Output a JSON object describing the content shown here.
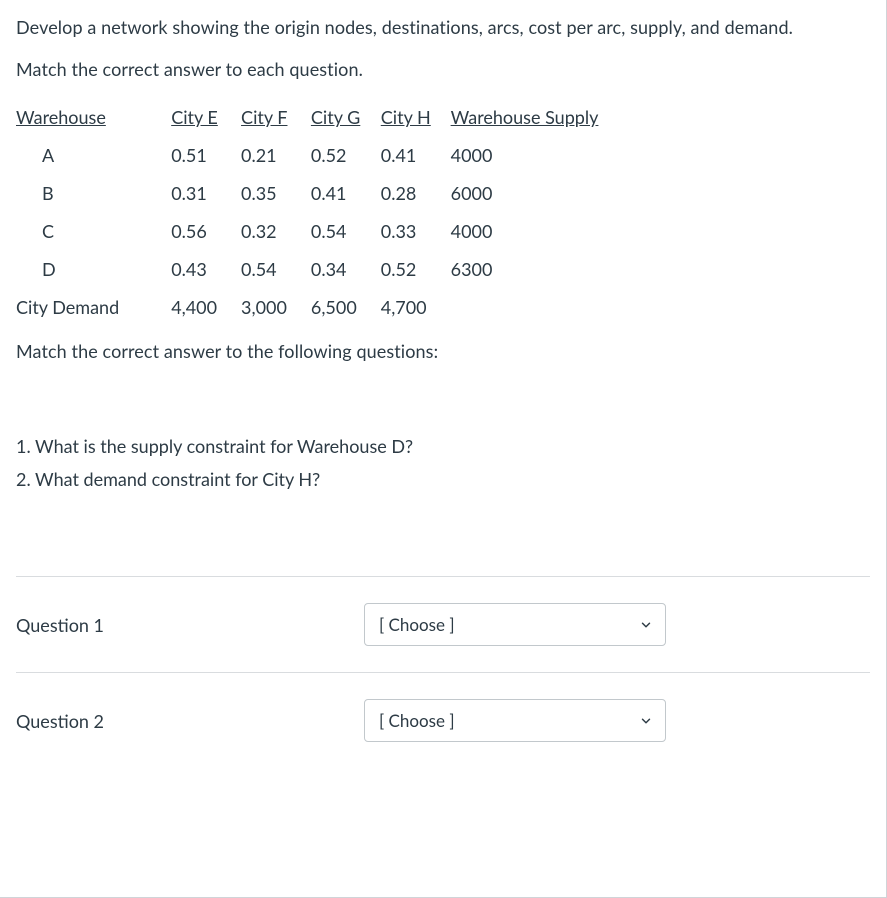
{
  "intro": "Develop a network showing the origin nodes, destinations, arcs, cost per arc, supply, and demand.",
  "instruction1": "Match the correct answer to each question.",
  "table": {
    "headers": [
      "Warehouse",
      "City E",
      "City F",
      "City G",
      "City H",
      "Warehouse Supply"
    ],
    "rows": [
      {
        "label": "A",
        "e": "0.51",
        "f": "0.21",
        "g": "0.52",
        "h": "0.41",
        "supply": "4000"
      },
      {
        "label": "B",
        "e": "0.31",
        "f": "0.35",
        "g": "0.41",
        "h": "0.28",
        "supply": "6000"
      },
      {
        "label": "C",
        "e": "0.56",
        "f": "0.32",
        "g": "0.54",
        "h": "0.33",
        "supply": "4000"
      },
      {
        "label": "D",
        "e": "0.43",
        "f": "0.54",
        "g": "0.34",
        "h": "0.52",
        "supply": "6300"
      }
    ],
    "demand": {
      "label": "City Demand",
      "e": "4,400",
      "f": "3,000",
      "g": "6,500",
      "h": "4,700",
      "supply": ""
    }
  },
  "instruction2": "Match the correct answer to the following questions:",
  "questions": {
    "q1": "1. What is the supply constraint for Warehouse D?",
    "q2": "2. What demand constraint for City H?"
  },
  "match": {
    "label1": "Question 1",
    "label2": "Question 2",
    "placeholder": "[ Choose ]"
  }
}
